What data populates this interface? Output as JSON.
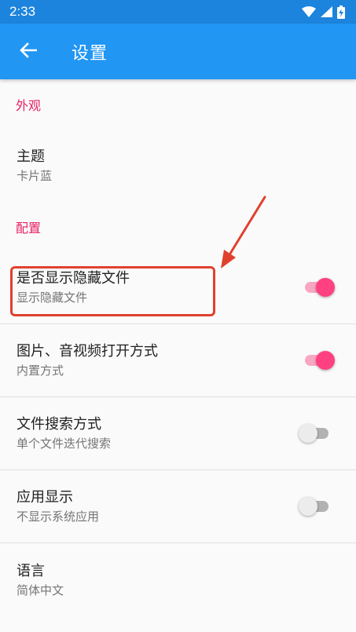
{
  "status_bar": {
    "time": "2:33",
    "icons": [
      "wifi-icon",
      "signal-icon",
      "battery-charging-icon"
    ]
  },
  "app_bar": {
    "title": "设置",
    "back_icon": "arrow-back-icon"
  },
  "sections": {
    "appearance": {
      "header": "外观",
      "theme": {
        "title": "主题",
        "summary": "卡片蓝"
      }
    },
    "config": {
      "header": "配置",
      "hidden_files": {
        "title": "是否显示隐藏文件",
        "summary": "显示隐藏文件",
        "enabled": true
      },
      "media_open": {
        "title": "图片、音视频打开方式",
        "summary": "内置方式",
        "enabled": true
      },
      "file_search": {
        "title": "文件搜索方式",
        "summary": "单个文件迭代搜索",
        "enabled": false
      },
      "app_display": {
        "title": "应用显示",
        "summary": "不显示系统应用",
        "enabled": false
      },
      "language": {
        "title": "语言",
        "summary": "简体中文"
      }
    }
  },
  "colors": {
    "status_bar": "#1c84dc",
    "app_bar": "#2196f3",
    "accent": "#e91e63",
    "switch_on": "#ff4081",
    "annotation": "#e0412e"
  }
}
